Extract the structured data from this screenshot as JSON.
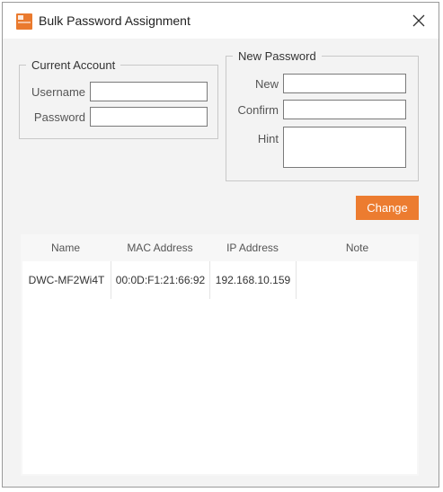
{
  "window": {
    "title": "Bulk Password Assignment",
    "accent_color": "#ec7c30",
    "close_icon": "close-icon",
    "app_icon": "app-icon"
  },
  "current_account": {
    "legend": "Current Account",
    "username_label": "Username",
    "username_value": "",
    "password_label": "Password",
    "password_value": ""
  },
  "new_password": {
    "legend": "New Password",
    "new_label": "New",
    "new_value": "",
    "confirm_label": "Confirm",
    "confirm_value": "",
    "hint_label": "Hint",
    "hint_value": ""
  },
  "change_button": {
    "label": "Change"
  },
  "device_table": {
    "columns": [
      "Name",
      "MAC Address",
      "IP Address",
      "Note"
    ],
    "rows": [
      [
        "DWC-MF2Wi4T",
        "00:0D:F1:21:66:92",
        "192.168.10.159",
        ""
      ]
    ]
  }
}
